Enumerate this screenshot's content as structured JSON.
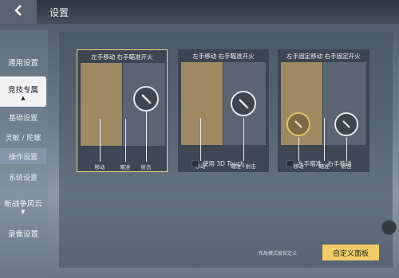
{
  "header": {
    "title": "设置",
    "back_icon": "chevron-left-icon"
  },
  "sidebar": {
    "items": [
      {
        "label": "通用设置"
      },
      {
        "label": "竞技专属",
        "active": true
      },
      {
        "label": "基础设置"
      },
      {
        "label": "灵敏 / 陀螺"
      },
      {
        "label": "操作设置",
        "active": true
      },
      {
        "label": "系统设置"
      },
      {
        "label": "新战争风云"
      },
      {
        "label": "录像设置"
      }
    ]
  },
  "cards": [
    {
      "title": "左手移动 右手瞄准开火",
      "selected": true,
      "labels": [
        "移动",
        "瞄准",
        "射击"
      ]
    },
    {
      "title": "左手移动 右手瞄准开火",
      "selected": false,
      "labels": [
        "移动",
        "瞄准+射击"
      ],
      "option": "使用 3D Touch"
    },
    {
      "title": "左手固定移动 右手固定开火",
      "selected": false,
      "labels": [
        "移动",
        "瞄准",
        "射击"
      ],
      "option": "左手瞄准，右手移动"
    }
  ],
  "footer": {
    "hint": "布局模式被自定义",
    "custom_button": "自定义面板"
  },
  "colors": {
    "accent": "#f1cd6a",
    "selected_border": "#e6d48a",
    "zone_left": "#9f8963",
    "zone_right": "#5b6471"
  }
}
